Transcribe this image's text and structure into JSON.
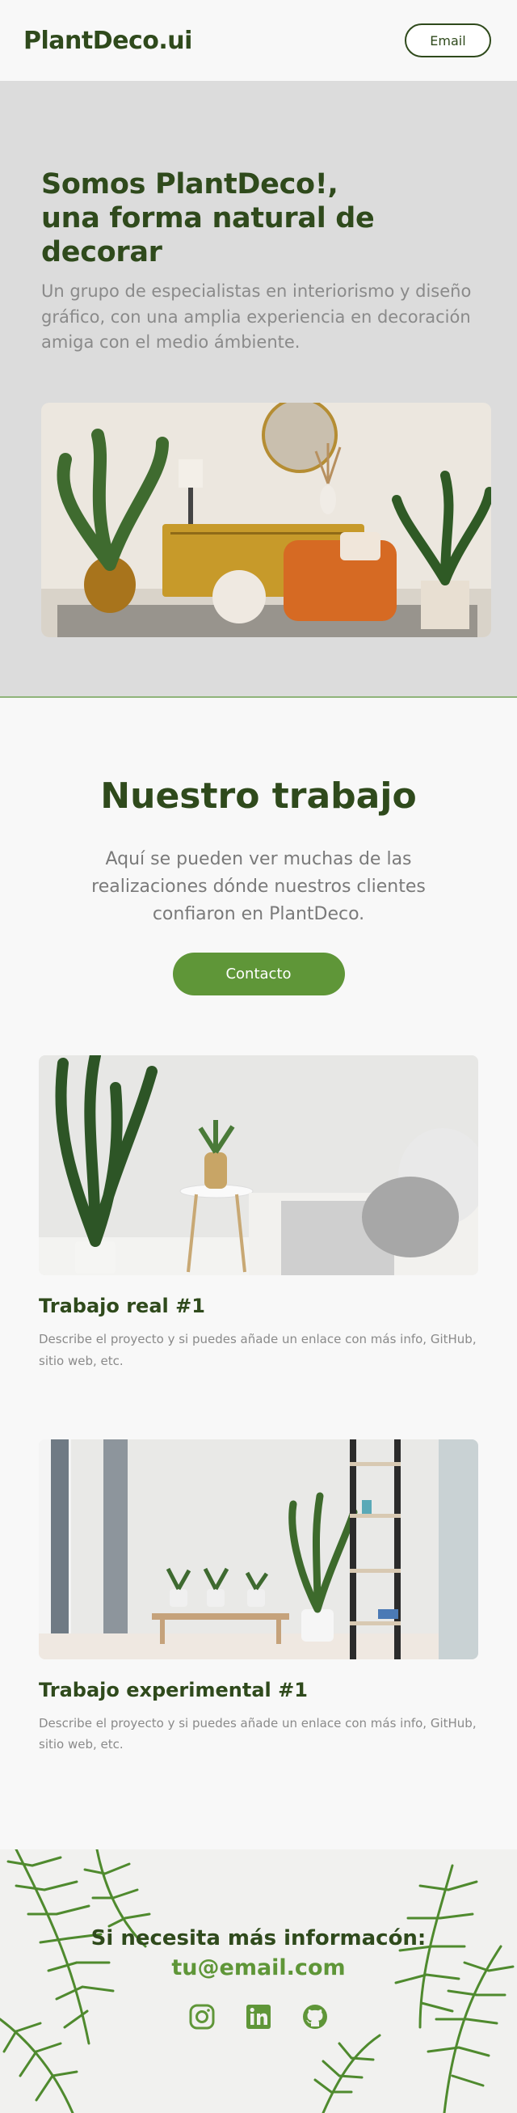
{
  "header": {
    "brand": "PlantDeco.ui",
    "email_button": "Email"
  },
  "hero": {
    "title_line1": "Somos PlantDeco!,",
    "title_line2": "una forma natural de decorar",
    "description": "Un grupo de especialistas en interiorismo y diseño gráfico, con una amplia experiencia en decoración amiga con el medio ámbiente."
  },
  "work": {
    "title": "Nuestro trabajo",
    "description": "Aquí se pueden ver muchas de las realizaciones dónde nuestros clientes confiaron en PlantDeco.",
    "contact_button": "Contacto",
    "projects": [
      {
        "title": "Trabajo real #1",
        "description": "Describe el proyecto y si puedes añade un enlace con más info, GitHub, sitio web, etc."
      },
      {
        "title": "Trabajo experimental #1",
        "description": "Describe el proyecto y si puedes añade un enlace con más info, GitHub, sitio web, etc."
      }
    ]
  },
  "footer": {
    "heading": "Si necesita más informacón:",
    "email": "tu@email.com",
    "social": [
      "instagram-icon",
      "linkedin-icon",
      "github-icon"
    ]
  },
  "colors": {
    "primary_dark": "#2f4a1c",
    "accent_green": "#5f9638",
    "hero_bg": "#dcdcdc",
    "page_bg": "#f8f8f8",
    "muted_text": "#8a8a8a"
  }
}
